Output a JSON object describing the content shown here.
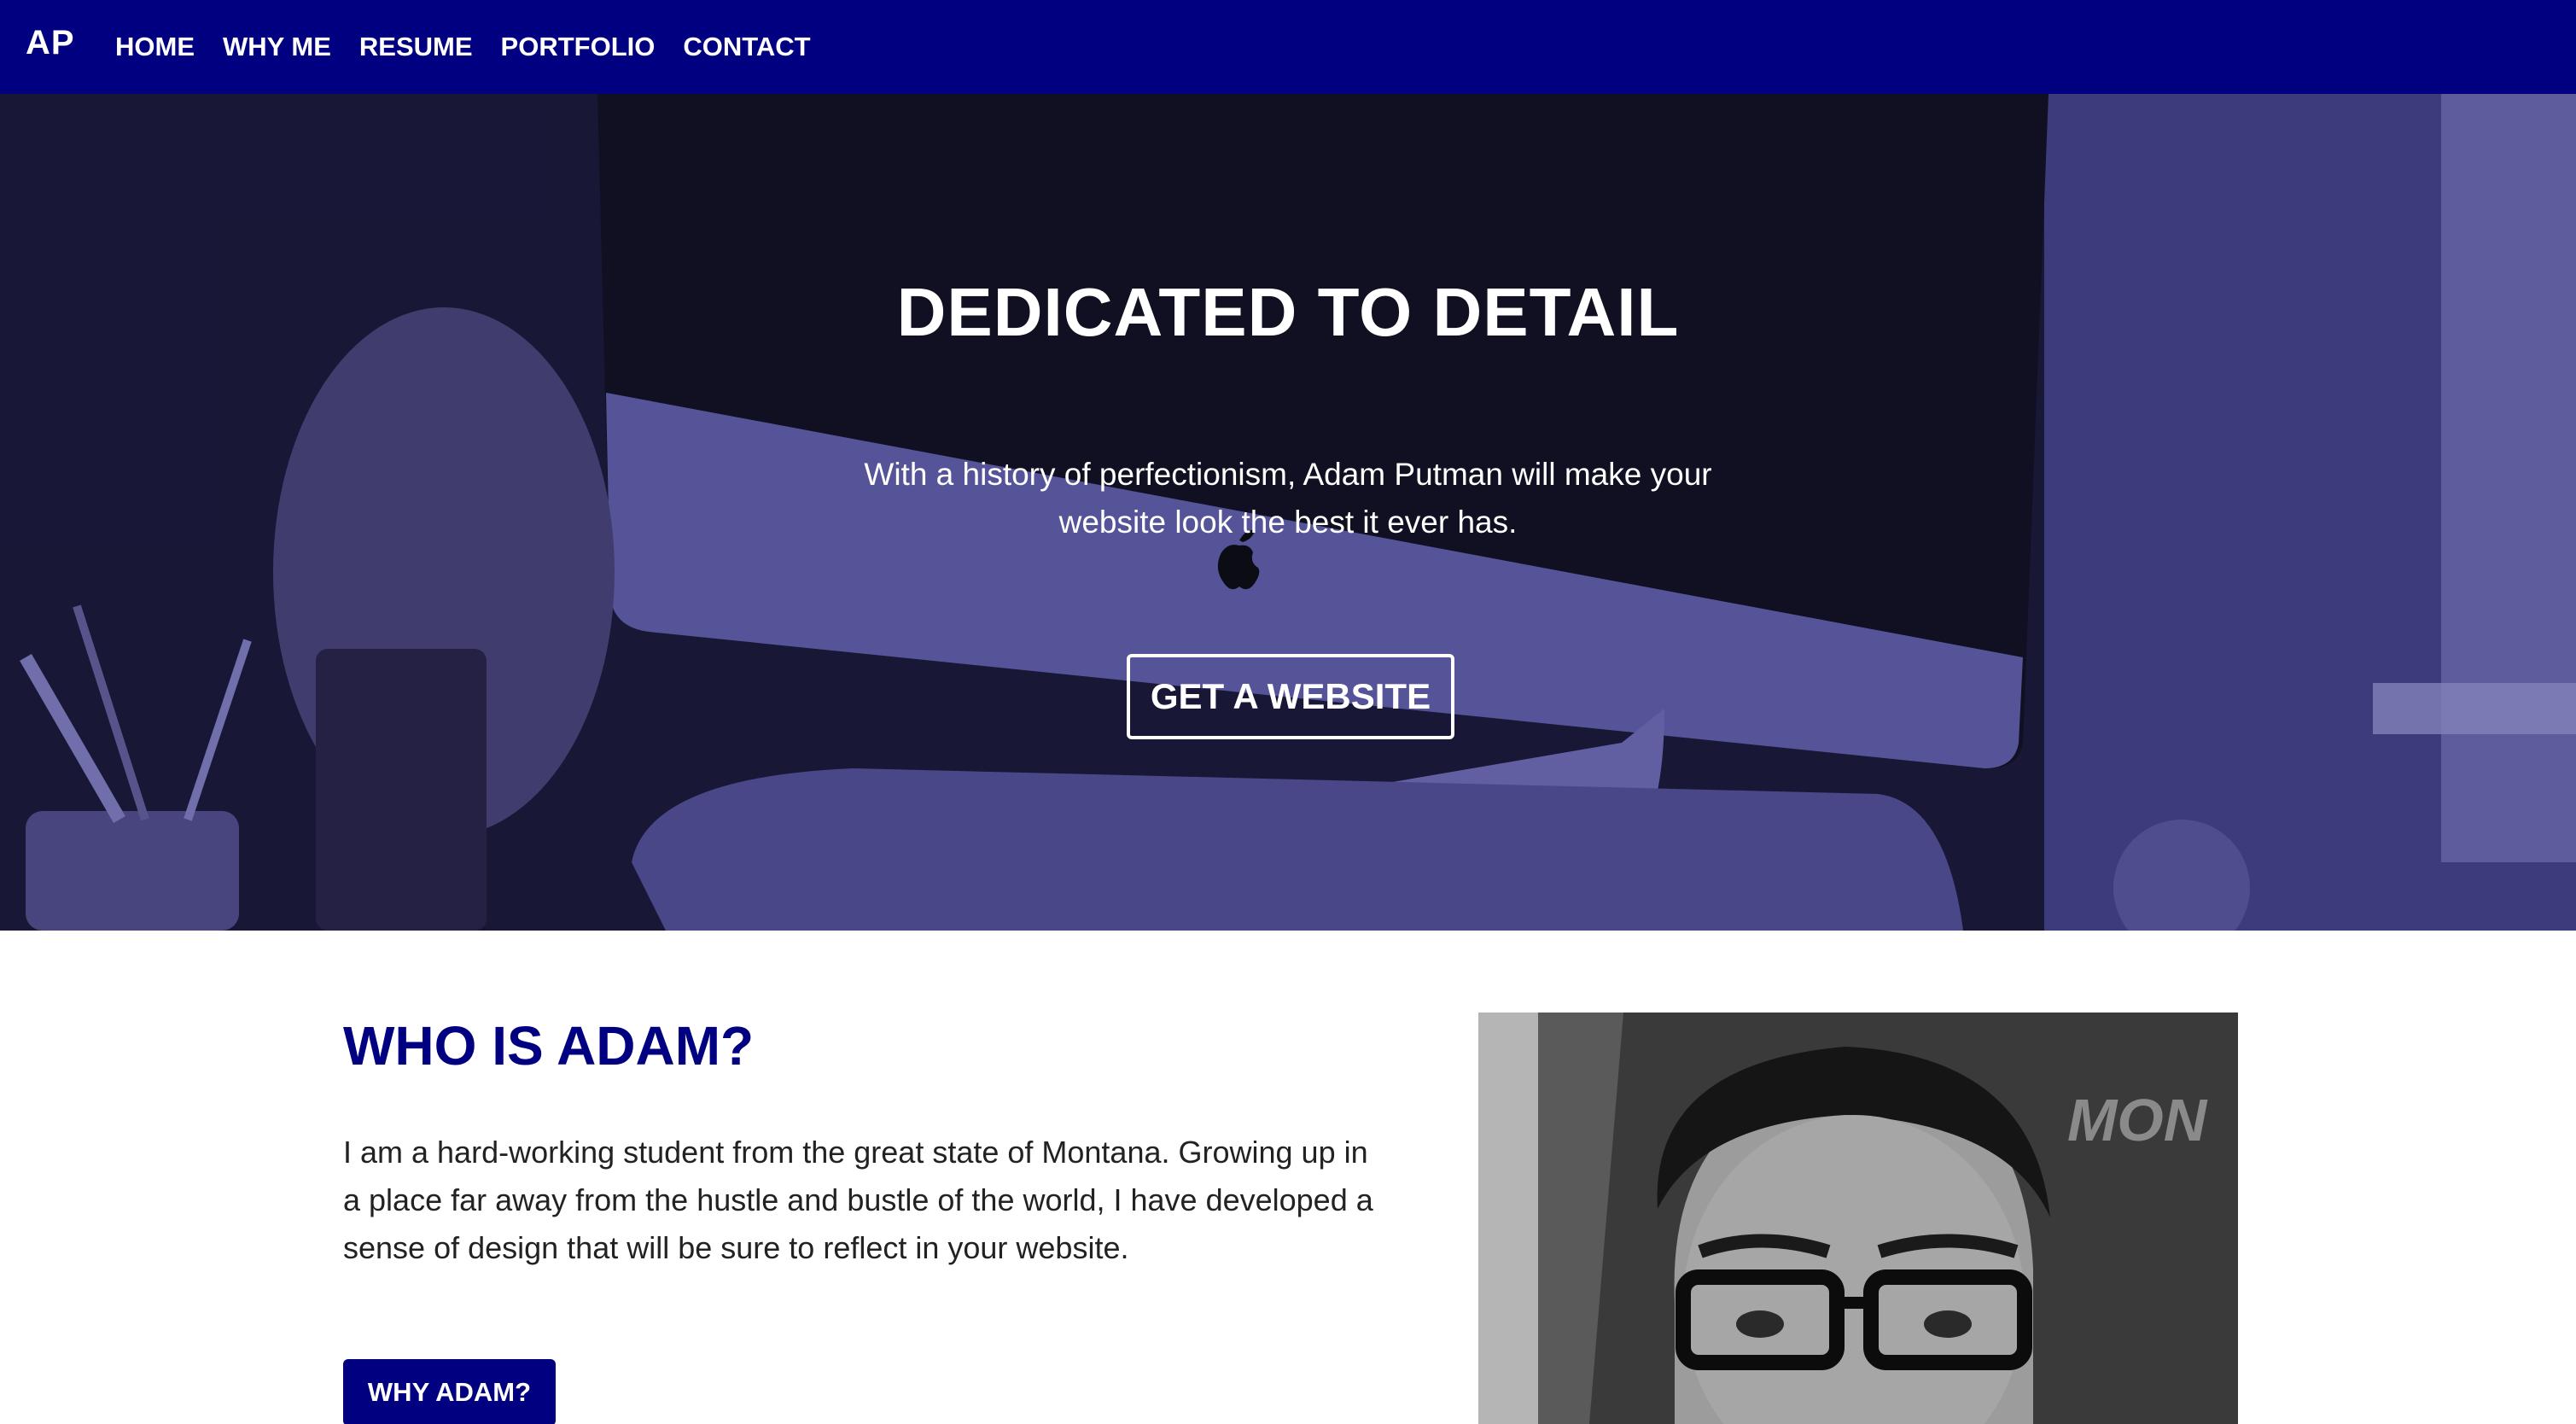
{
  "nav": {
    "logo": "AP",
    "links": [
      "HOME",
      "WHY ME",
      "RESUME",
      "PORTFOLIO",
      "CONTACT"
    ]
  },
  "hero": {
    "title": "DEDICATED TO DETAIL",
    "subtitle_line1": "With a history of perfectionism, Adam Putman will make your",
    "subtitle_line2": "website look the best it ever has.",
    "cta_label": "GET A WEBSITE"
  },
  "about": {
    "title": "WHO IS ADAM?",
    "text_line1": "I am a hard-working student from the great state of Montana. Growing up in",
    "text_line2": "a place far away from the hustle and bustle of the world, I have developed a",
    "text_line3": "sense of design that will be sure to reflect in your website.",
    "cta_label": "WHY ADAM?",
    "portrait_flag_text": "MON"
  },
  "colors": {
    "brand": "#000080",
    "hero_tint": "#4c4a93",
    "text": "#222222"
  },
  "icons": [
    "apple-logo-icon"
  ]
}
